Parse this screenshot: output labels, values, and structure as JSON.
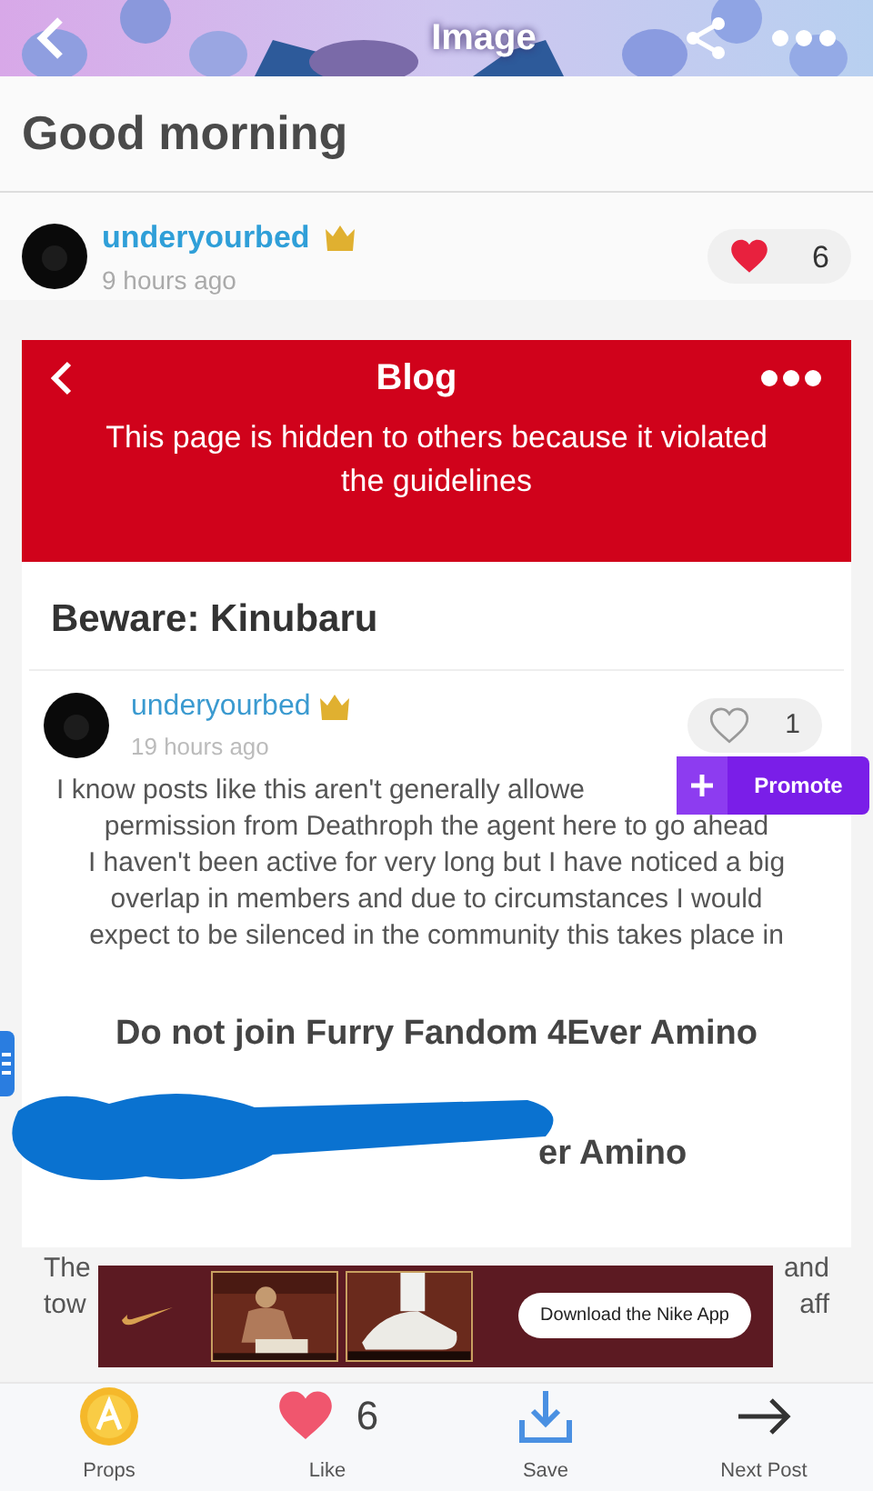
{
  "header": {
    "title": "Image"
  },
  "post": {
    "title": "Good morning",
    "author": "underyourbed",
    "time": "9 hours ago",
    "likes": "6",
    "liked": true
  },
  "screenshot": {
    "bar_title": "Blog",
    "notice": "This page is hidden to others because it violated the guidelines",
    "blog_title": "Beware: Kinubaru",
    "author": "underyourbed",
    "time": "19 hours ago",
    "likes": "1",
    "liked": false,
    "promote": "Promote",
    "body_lines": [
      "I know posts like this aren't generally allowe",
      "permission from Deathroph the agent here to go ahead",
      "I haven't been active for very long but I have noticed a big",
      "overlap in members and due to circumstances I would",
      "expect to be silenced in the community this takes place in"
    ],
    "heading": "Do not join Furry Fandom 4Ever Amino",
    "redacted_heading": "er Amino",
    "footer_lines": [
      {
        "left": "The",
        "right": "and"
      },
      {
        "left": "tow",
        "right": "aff"
      }
    ]
  },
  "ad": {
    "button": "Download the Nike App"
  },
  "toolbar": [
    {
      "kind": "props",
      "label": "Props"
    },
    {
      "kind": "like",
      "label": "Like",
      "count": "6",
      "liked": true
    },
    {
      "kind": "save",
      "label": "Save"
    },
    {
      "kind": "next",
      "label": "Next Post"
    }
  ]
}
